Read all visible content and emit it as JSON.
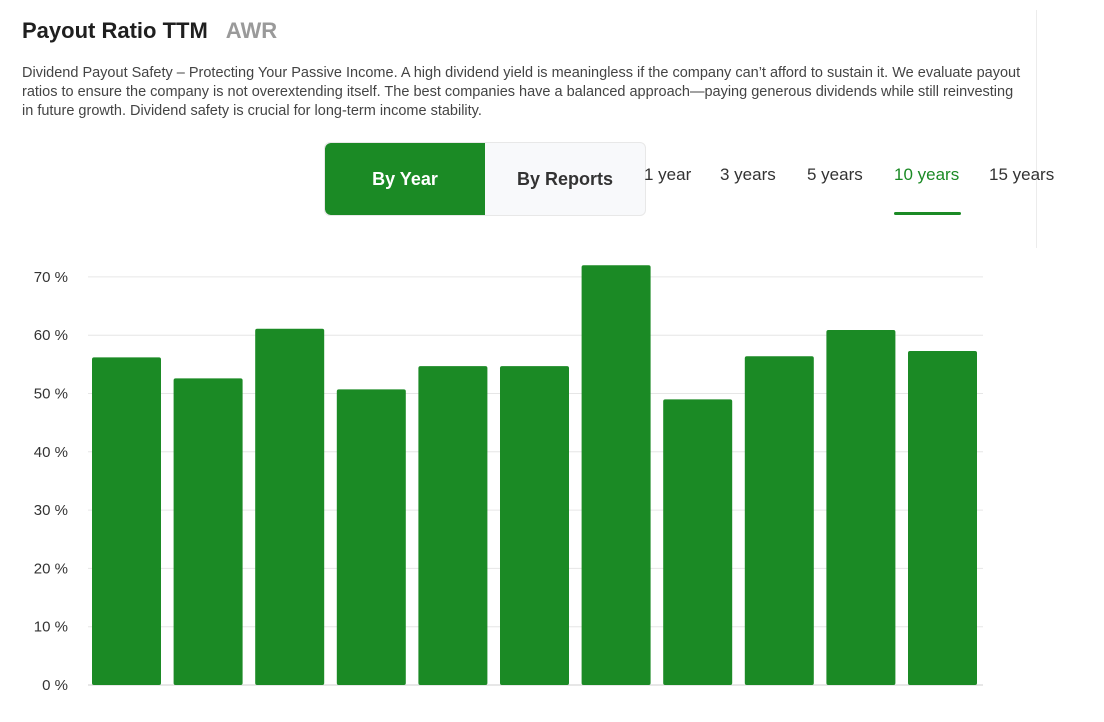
{
  "header": {
    "title": "Payout Ratio TTM",
    "ticker": "AWR",
    "description": "Dividend Payout Safety – Protecting Your Passive Income. A high dividend yield is meaningless if the company can’t afford to sustain it. We evaluate payout ratios to ensure the company is not overextending itself. The best companies have a balanced approach—paying generous dividends while still reinvesting in future growth. Dividend safety is crucial for long-term income stability."
  },
  "toggle": {
    "by_year": "By Year",
    "by_reports": "By Reports",
    "active": "by_year"
  },
  "periods": {
    "items": [
      "1 year",
      "3 years",
      "5 years",
      "10 years",
      "15 years"
    ],
    "active": "10 years"
  },
  "colors": {
    "accent": "#1b8a25",
    "grid": "#e6e6e6"
  },
  "chart_data": {
    "type": "bar",
    "categories": [],
    "values": [
      56.2,
      52.6,
      61.1,
      50.7,
      54.7,
      54.7,
      72.0,
      49.0,
      56.4,
      60.9,
      57.3
    ],
    "ylim": [
      0,
      70
    ],
    "y_ticks": [
      0,
      10,
      20,
      30,
      40,
      50,
      60,
      70
    ],
    "y_tick_labels": [
      "0 %",
      "10 %",
      "20 %",
      "30 %",
      "40 %",
      "50 %",
      "60 %",
      "70 %"
    ],
    "grid": true,
    "color": "#1b8a25"
  }
}
